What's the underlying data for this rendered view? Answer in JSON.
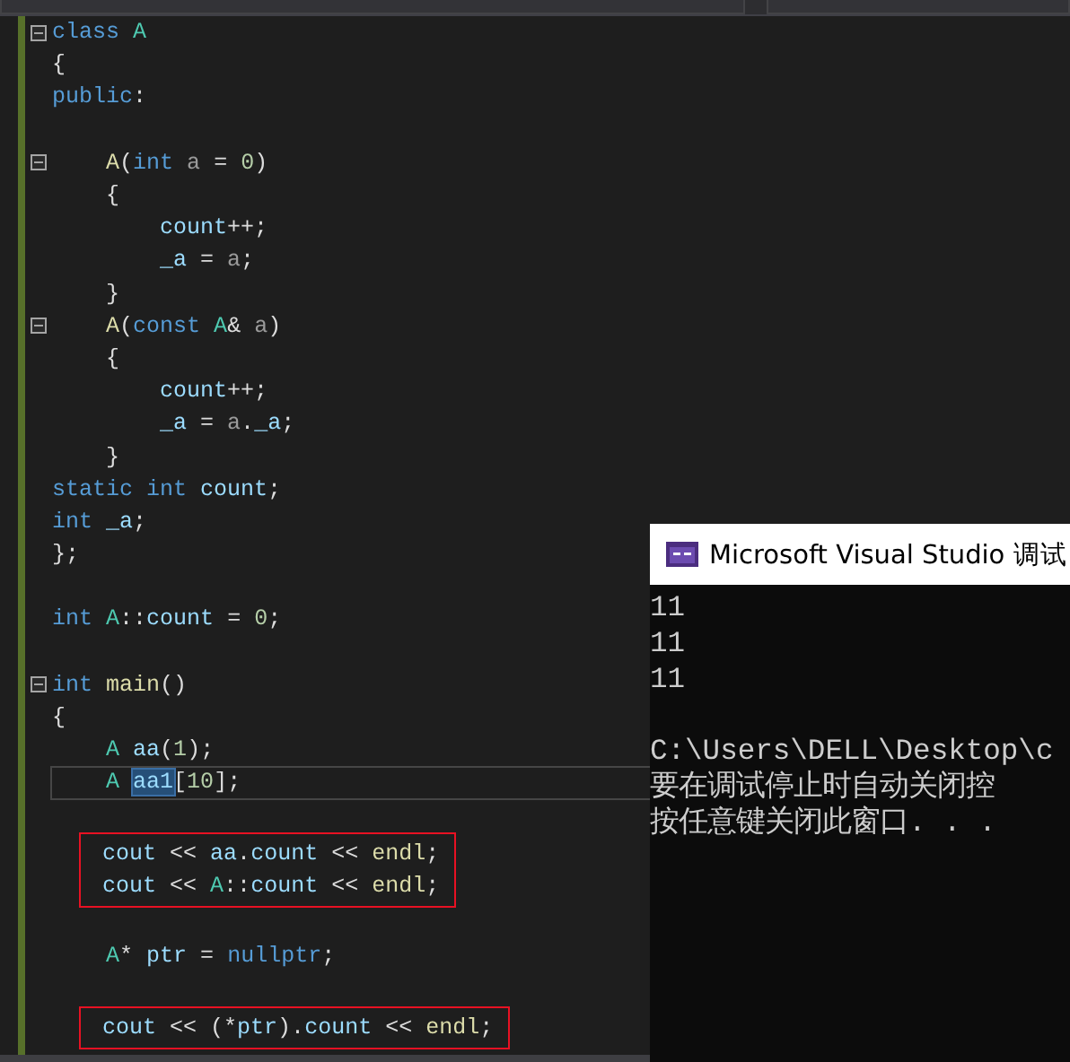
{
  "code_lines": [
    {
      "fold": true,
      "boxed": false,
      "current": false,
      "tokens": [
        {
          "text": "class ",
          "kind": "keyword"
        },
        {
          "text": "A",
          "kind": "type"
        }
      ]
    },
    {
      "fold": false,
      "boxed": false,
      "current": false,
      "tokens": [
        {
          "text": "{",
          "kind": "plain"
        }
      ]
    },
    {
      "fold": false,
      "boxed": false,
      "current": false,
      "tokens": [
        {
          "text": "public",
          "kind": "keyword"
        },
        {
          "text": ":",
          "kind": "plain"
        }
      ]
    },
    {
      "fold": false,
      "boxed": false,
      "current": false
    },
    {
      "fold": true,
      "boxed": false,
      "current": false,
      "tokens": [
        {
          "text": "    A",
          "kind": "function"
        },
        {
          "text": "(",
          "kind": "plain"
        },
        {
          "text": "int ",
          "kind": "keyword"
        },
        {
          "text": "a",
          "kind": "param"
        },
        {
          "text": " = ",
          "kind": "plain"
        },
        {
          "text": "0",
          "kind": "number"
        },
        {
          "text": ")",
          "kind": "plain"
        }
      ]
    },
    {
      "fold": false,
      "boxed": false,
      "current": false,
      "tokens": [
        {
          "text": "    {",
          "kind": "plain"
        }
      ]
    },
    {
      "fold": false,
      "boxed": false,
      "current": false,
      "tokens": [
        {
          "text": "        count",
          "kind": "variable"
        },
        {
          "text": "++;",
          "kind": "plain"
        }
      ]
    },
    {
      "fold": false,
      "boxed": false,
      "current": false,
      "tokens": [
        {
          "text": "        _a",
          "kind": "variable"
        },
        {
          "text": " = ",
          "kind": "plain"
        },
        {
          "text": "a",
          "kind": "param"
        },
        {
          "text": ";",
          "kind": "plain"
        }
      ]
    },
    {
      "fold": false,
      "boxed": false,
      "current": false,
      "tokens": [
        {
          "text": "    }",
          "kind": "plain"
        }
      ]
    },
    {
      "fold": true,
      "boxed": false,
      "current": false,
      "tokens": [
        {
          "text": "    A",
          "kind": "function"
        },
        {
          "text": "(",
          "kind": "plain"
        },
        {
          "text": "const ",
          "kind": "keyword"
        },
        {
          "text": "A",
          "kind": "type"
        },
        {
          "text": "& ",
          "kind": "plain"
        },
        {
          "text": "a",
          "kind": "param"
        },
        {
          "text": ")",
          "kind": "plain"
        }
      ]
    },
    {
      "fold": false,
      "boxed": false,
      "current": false,
      "tokens": [
        {
          "text": "    {",
          "kind": "plain"
        }
      ]
    },
    {
      "fold": false,
      "boxed": false,
      "current": false,
      "tokens": [
        {
          "text": "        count",
          "kind": "variable"
        },
        {
          "text": "++;",
          "kind": "plain"
        }
      ]
    },
    {
      "fold": false,
      "boxed": false,
      "current": false,
      "tokens": [
        {
          "text": "        _a",
          "kind": "variable"
        },
        {
          "text": " = ",
          "kind": "plain"
        },
        {
          "text": "a",
          "kind": "param"
        },
        {
          "text": ".",
          "kind": "plain"
        },
        {
          "text": "_a",
          "kind": "variable"
        },
        {
          "text": ";",
          "kind": "plain"
        }
      ]
    },
    {
      "fold": false,
      "boxed": false,
      "current": false,
      "tokens": [
        {
          "text": "    }",
          "kind": "plain"
        }
      ]
    },
    {
      "fold": false,
      "boxed": false,
      "current": false,
      "tokens": [
        {
          "text": "static int ",
          "kind": "keyword"
        },
        {
          "text": "count",
          "kind": "variable"
        },
        {
          "text": ";",
          "kind": "plain"
        }
      ]
    },
    {
      "fold": false,
      "boxed": false,
      "current": false,
      "tokens": [
        {
          "text": "int ",
          "kind": "keyword"
        },
        {
          "text": "_a",
          "kind": "variable"
        },
        {
          "text": ";",
          "kind": "plain"
        }
      ]
    },
    {
      "fold": false,
      "boxed": false,
      "current": false,
      "tokens": [
        {
          "text": "};",
          "kind": "plain"
        }
      ]
    },
    {
      "fold": false,
      "boxed": false,
      "current": false
    },
    {
      "fold": false,
      "boxed": false,
      "current": false,
      "tokens": [
        {
          "text": "int ",
          "kind": "keyword"
        },
        {
          "text": "A",
          "kind": "type"
        },
        {
          "text": "::",
          "kind": "plain"
        },
        {
          "text": "count",
          "kind": "variable"
        },
        {
          "text": " = ",
          "kind": "plain"
        },
        {
          "text": "0",
          "kind": "number"
        },
        {
          "text": ";",
          "kind": "plain"
        }
      ]
    },
    {
      "fold": false,
      "boxed": false,
      "current": false
    },
    {
      "fold": true,
      "boxed": false,
      "current": false,
      "tokens": [
        {
          "text": "int ",
          "kind": "keyword"
        },
        {
          "text": "main",
          "kind": "function"
        },
        {
          "text": "()",
          "kind": "plain"
        }
      ]
    },
    {
      "fold": false,
      "boxed": false,
      "current": false,
      "tokens": [
        {
          "text": "{",
          "kind": "plain"
        }
      ]
    },
    {
      "fold": false,
      "boxed": false,
      "current": false,
      "tokens": [
        {
          "text": "    A ",
          "kind": "type"
        },
        {
          "text": "aa",
          "kind": "variable"
        },
        {
          "text": "(",
          "kind": "plain"
        },
        {
          "text": "1",
          "kind": "number"
        },
        {
          "text": ");",
          "kind": "plain"
        }
      ]
    },
    {
      "fold": false,
      "boxed": false,
      "current": true,
      "tokens": [
        {
          "text": "    A ",
          "kind": "type"
        },
        {
          "text": "aa1",
          "kind": "selected"
        },
        {
          "text": "[",
          "kind": "plain"
        },
        {
          "text": "10",
          "kind": "number"
        },
        {
          "text": "];",
          "kind": "plain"
        }
      ]
    },
    {
      "fold": false,
      "boxed": false,
      "current": false
    },
    {
      "fold": false,
      "boxed": true,
      "current": false,
      "tokens": [
        {
          "text": "cout",
          "kind": "variable"
        },
        {
          "text": " << ",
          "kind": "plain"
        },
        {
          "text": "aa",
          "kind": "variable"
        },
        {
          "text": ".",
          "kind": "plain"
        },
        {
          "text": "count",
          "kind": "variable"
        },
        {
          "text": " << ",
          "kind": "plain"
        },
        {
          "text": "endl",
          "kind": "function"
        },
        {
          "text": ";",
          "kind": "plain"
        }
      ]
    },
    {
      "fold": false,
      "boxed": true,
      "current": false,
      "tokens": [
        {
          "text": "cout",
          "kind": "variable"
        },
        {
          "text": " << ",
          "kind": "plain"
        },
        {
          "text": "A",
          "kind": "type"
        },
        {
          "text": "::",
          "kind": "plain"
        },
        {
          "text": "count",
          "kind": "variable"
        },
        {
          "text": " << ",
          "kind": "plain"
        },
        {
          "text": "endl",
          "kind": "function"
        },
        {
          "text": ";",
          "kind": "plain"
        }
      ]
    },
    {
      "fold": false,
      "boxed": false,
      "current": false
    },
    {
      "fold": false,
      "boxed": false,
      "current": false,
      "tokens": [
        {
          "text": "    A",
          "kind": "type"
        },
        {
          "text": "* ",
          "kind": "plain"
        },
        {
          "text": "ptr",
          "kind": "variable"
        },
        {
          "text": " = ",
          "kind": "plain"
        },
        {
          "text": "nullptr",
          "kind": "keyword"
        },
        {
          "text": ";",
          "kind": "plain"
        }
      ]
    },
    {
      "fold": false,
      "boxed": false,
      "current": false
    },
    {
      "fold": false,
      "boxed": true,
      "current": false,
      "tokens": [
        {
          "text": "cout",
          "kind": "variable"
        },
        {
          "text": " << (*",
          "kind": "plain"
        },
        {
          "text": "ptr",
          "kind": "variable"
        },
        {
          "text": ").",
          "kind": "plain"
        },
        {
          "text": "count",
          "kind": "variable"
        },
        {
          "text": " << ",
          "kind": "plain"
        },
        {
          "text": "endl",
          "kind": "function"
        },
        {
          "text": ";",
          "kind": "plain"
        }
      ]
    }
  ],
  "console": {
    "title": "Microsoft Visual Studio 调试",
    "output": [
      "11",
      "11",
      "11"
    ],
    "messages": [
      "C:\\Users\\DELL\\Desktop\\c",
      "要在调试停止时自动关闭控",
      "按任意键关闭此窗口. . ."
    ]
  }
}
